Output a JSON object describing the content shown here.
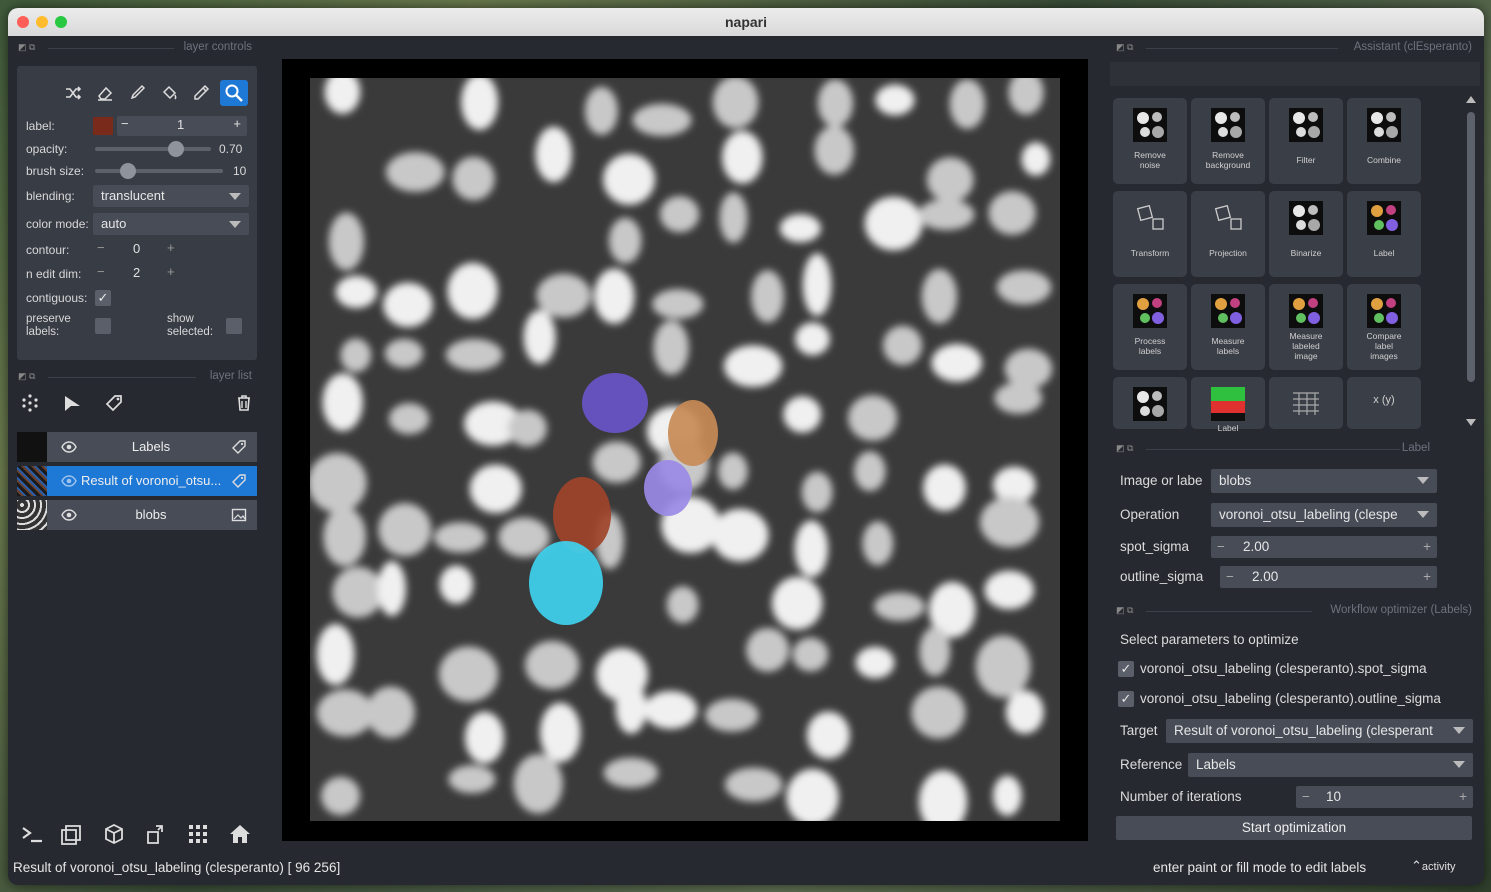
{
  "window": {
    "title": "napari"
  },
  "layer_controls": {
    "header": "layer controls",
    "label_label": "label:",
    "label_value": "1",
    "label_color": "#7a2a1a",
    "opacity_label": "opacity:",
    "opacity_value": "0.70",
    "opacity_fraction": 0.7,
    "brush_label": "brush size:",
    "brush_value": "10",
    "blending_label": "blending:",
    "blending_value": "translucent",
    "color_mode_label": "color mode:",
    "color_mode_value": "auto",
    "contour_label": "contour:",
    "contour_value": "0",
    "n_edit_dim_label": "n edit dim:",
    "n_edit_dim_value": "2",
    "contiguous_label": "contiguous:",
    "preserve_label_1": "preserve",
    "preserve_label_2": "labels:",
    "show_selected_1": "show",
    "show_selected_2": "selected:",
    "minus": "−",
    "plus": "+",
    "check": "✓"
  },
  "layer_list": {
    "header": "layer list",
    "layers": [
      {
        "name": "Labels",
        "selected": false
      },
      {
        "name": "Result of voronoi_otsu...",
        "selected": true
      },
      {
        "name": "blobs",
        "selected": false
      }
    ]
  },
  "assistant": {
    "header": "Assistant (clEsperanto)",
    "tiles": [
      {
        "caption_1": "Remove",
        "caption_2": "noise",
        "icon": "remove-noise-icon"
      },
      {
        "caption_1": "Remove",
        "caption_2": "background",
        "icon": "remove-background-icon"
      },
      {
        "caption_1": "Filter",
        "caption_2": "",
        "icon": "filter-icon"
      },
      {
        "caption_1": "Combine",
        "caption_2": "",
        "icon": "combine-icon"
      },
      {
        "caption_1": "Transform",
        "caption_2": "",
        "icon": "transform-icon"
      },
      {
        "caption_1": "Projection",
        "caption_2": "",
        "icon": "projection-icon"
      },
      {
        "caption_1": "Binarize",
        "caption_2": "",
        "icon": "binarize-icon"
      },
      {
        "caption_1": "Label",
        "caption_2": "",
        "icon": "label-icon"
      },
      {
        "caption_1": "Process",
        "caption_2": "labels",
        "icon": "process-labels-icon"
      },
      {
        "caption_1": "Measure",
        "caption_2": "labels",
        "icon": "measure-labels-icon"
      },
      {
        "caption_1": "Measure",
        "caption_2": "labeled",
        "caption_3": "image",
        "icon": "measure-labeled-image-icon"
      },
      {
        "caption_1": "Compare",
        "caption_2": "label",
        "caption_3": "images",
        "icon": "compare-label-images-icon"
      },
      {
        "caption_1": "",
        "caption_2": "",
        "icon": "mesh-icon"
      },
      {
        "caption_1": "Label",
        "caption_2": "",
        "icon": "label-map-icon"
      },
      {
        "caption_1": "",
        "caption_2": "",
        "icon": "table-icon"
      },
      {
        "caption_1": "x (y)",
        "caption_2": "",
        "icon": "function-icon"
      }
    ]
  },
  "label_panel": {
    "header": "Label",
    "image_label": "Image or labe",
    "image_value": "blobs",
    "operation_label": "Operation",
    "operation_value": "voronoi_otsu_labeling (clespe",
    "spot_sigma_label": "spot_sigma",
    "spot_sigma_value": "2.00",
    "outline_sigma_label": "outline_sigma",
    "outline_sigma_value": "2.00"
  },
  "optimizer": {
    "header": "Workflow optimizer (Labels)",
    "select_label": "Select parameters to optimize",
    "param_1": "voronoi_otsu_labeling (clesperanto).spot_sigma",
    "param_2": "voronoi_otsu_labeling (clesperanto).outline_sigma",
    "target_label": "Target",
    "target_value": "Result of voronoi_otsu_labeling (clesperant",
    "reference_label": "Reference",
    "reference_value": "Labels",
    "iterations_label": "Number of iterations",
    "iterations_value": "10",
    "start_button": "Start optimization"
  },
  "status_bar": {
    "left": "Result of voronoi_otsu_labeling (clesperanto) [ 96 256]",
    "right": "enter paint or fill mode to edit labels",
    "activity": "activity"
  },
  "colors": {
    "accent": "#1e78d6",
    "label_purple": "#6a55c8",
    "label_lavender": "#9a8ae6",
    "label_orange": "#c88a56",
    "label_red": "#a0432a",
    "label_cyan": "#3fd2f0"
  }
}
